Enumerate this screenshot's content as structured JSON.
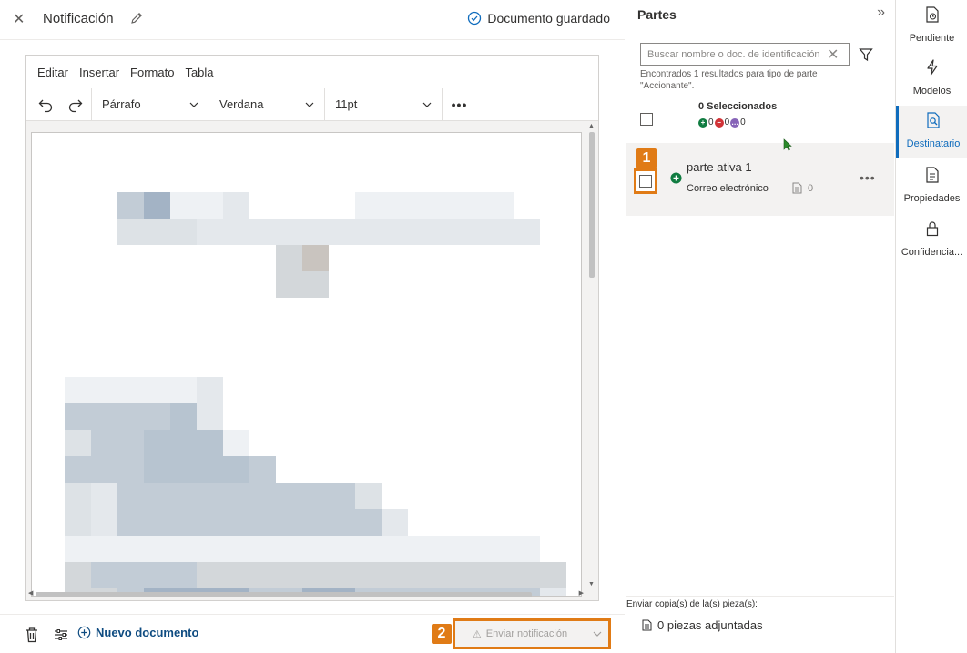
{
  "header": {
    "title": "Notificación",
    "saved_status": "Documento guardado"
  },
  "editor": {
    "menu": [
      "Editar",
      "Insertar",
      "Formato",
      "Tabla"
    ],
    "paragraph_style": "Párrafo",
    "font_family": "Verdana",
    "font_size": "11pt"
  },
  "footer": {
    "new_document": "Nuevo documento",
    "send_button": "Enviar notificación",
    "badge_2": "2"
  },
  "parts_panel": {
    "title": "Partes",
    "search_placeholder": "Buscar nombre o doc. de identificación",
    "found_text": "Encontrados 1 resultados para tipo de parte \"Accionante\".",
    "selected_count": "0 Seleccionados",
    "status_counts": [
      "0",
      "0",
      "0"
    ],
    "badge_1": "1",
    "party": {
      "name": "parte ativa 1",
      "channel": "Correo electrónico",
      "doc_count": "0"
    },
    "copies_label": "Enviar copia(s) de la(s) pieza(s):",
    "copies_value": "0 piezas adjuntadas"
  },
  "side_nav": {
    "items": [
      {
        "label": "Pendiente",
        "icon": "pending-doc-icon"
      },
      {
        "label": "Modelos",
        "icon": "lightning-icon"
      },
      {
        "label": "Destinatario",
        "icon": "recipient-doc-icon"
      },
      {
        "label": "Propiedades",
        "icon": "properties-doc-icon"
      },
      {
        "label": "Confidencia...",
        "icon": "lock-icon"
      }
    ],
    "active": "Destinatario"
  },
  "colors": {
    "accent": "#0f6cbd",
    "highlight": "#e07b16",
    "link": "#0f4c81",
    "status_green": "#107c41",
    "status_red": "#d13438",
    "status_purple": "#8764b8"
  }
}
